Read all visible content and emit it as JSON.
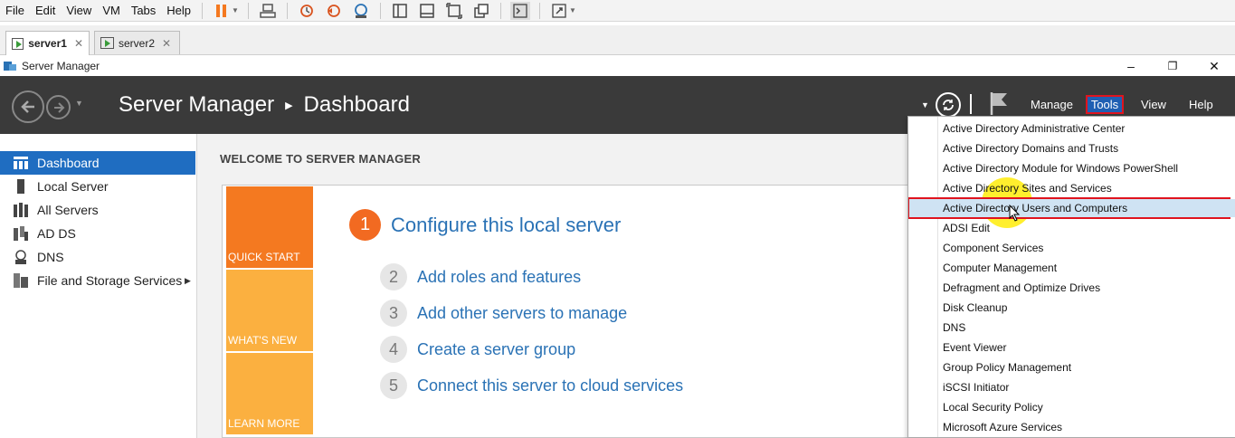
{
  "vm_menubar": {
    "menus": [
      "File",
      "Edit",
      "View",
      "VM",
      "Tabs",
      "Help"
    ],
    "toolbar_icons": [
      "pause-icon",
      "send-ctrl-alt-del-icon",
      "snapshot-take-icon",
      "snapshot-revert-icon",
      "snapshot-manager-icon",
      "sidebar-view-icon",
      "console-view-icon",
      "fit-guest-icon",
      "unity-icon",
      "terminal-icon",
      "fullscreen-icon"
    ]
  },
  "vm_tabs": [
    {
      "label": "server1",
      "active": true
    },
    {
      "label": "server2",
      "active": false
    }
  ],
  "window": {
    "title": "Server Manager",
    "minimize": "–",
    "restore": "❐",
    "close": "✕"
  },
  "header": {
    "app": "Server Manager",
    "page": "Dashboard",
    "menus": {
      "manage": "Manage",
      "tools": "Tools",
      "view": "View",
      "help": "Help"
    }
  },
  "nav": {
    "items": [
      {
        "label": "Dashboard",
        "icon": "dashboard-icon",
        "active": true
      },
      {
        "label": "Local Server",
        "icon": "local-server-icon"
      },
      {
        "label": "All Servers",
        "icon": "all-servers-icon"
      },
      {
        "label": "AD DS",
        "icon": "ad-ds-icon"
      },
      {
        "label": "DNS",
        "icon": "dns-icon"
      },
      {
        "label": "File and Storage Services",
        "icon": "file-storage-icon",
        "has_submenu": true
      }
    ]
  },
  "main": {
    "welcome_title": "WELCOME TO SERVER MANAGER",
    "blocks": [
      "QUICK START",
      "WHAT'S NEW",
      "LEARN MORE"
    ],
    "steps": [
      {
        "num": "1",
        "label": "Configure this local server"
      },
      {
        "num": "2",
        "label": "Add roles and features"
      },
      {
        "num": "3",
        "label": "Add other servers to manage"
      },
      {
        "num": "4",
        "label": "Create a server group"
      },
      {
        "num": "5",
        "label": "Connect this server to cloud services"
      }
    ]
  },
  "tools_menu": {
    "items": [
      "Active Directory Administrative Center",
      "Active Directory Domains and Trusts",
      "Active Directory Module for Windows PowerShell",
      "Active Directory Sites and Services",
      "Active Directory Users and Computers",
      "ADSI Edit",
      "Component Services",
      "Computer Management",
      "Defragment and Optimize Drives",
      "Disk Cleanup",
      "DNS",
      "Event Viewer",
      "Group Policy Management",
      "iSCSI Initiator",
      "Local Security Policy",
      "Microsoft Azure Services"
    ],
    "highlighted_index": 4
  },
  "colors": {
    "header_bg": "#3a3a3a",
    "accent_blue": "#1f6dc1",
    "quick_start": "#f47920",
    "whats_new": "#fbb040",
    "learn_more": "#fbb040",
    "highlight_red": "#e0141e"
  }
}
